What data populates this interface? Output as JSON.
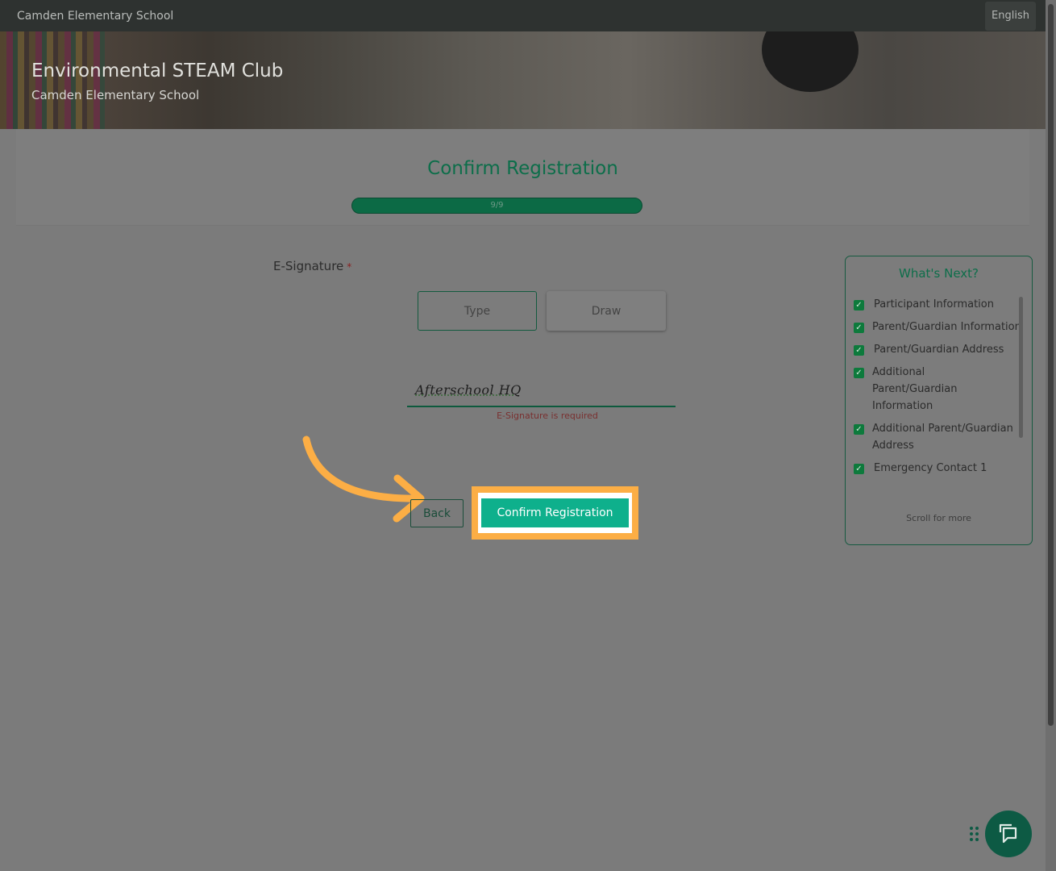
{
  "topbar": {
    "school_name": "Camden Elementary School",
    "language_button": "English"
  },
  "hero": {
    "title": "Environmental STEAM Club",
    "subtitle": "Camden Elementary School"
  },
  "header": {
    "heading": "Confirm Registration",
    "progress_label": "9/9",
    "progress_fraction": 1.0
  },
  "signature": {
    "label": "E-Signature",
    "required_marker": "*",
    "tabs": [
      {
        "label": "Type",
        "selected": true
      },
      {
        "label": "Draw",
        "selected": false
      }
    ],
    "value": "Afterschool HQ",
    "error": "E-Signature is required"
  },
  "actions": {
    "back_label": "Back",
    "confirm_label": "Confirm Registration"
  },
  "whats_next": {
    "title": "What's Next?",
    "items": [
      {
        "label": "Participant Information",
        "checked": true
      },
      {
        "label": "Parent/Guardian Information",
        "checked": true
      },
      {
        "label": "Parent/Guardian Address",
        "checked": true
      },
      {
        "label": "Additional Parent/Guardian Information",
        "checked": true
      },
      {
        "label": "Additional Parent/Guardian Address",
        "checked": true
      },
      {
        "label": "Emergency Contact 1",
        "checked": true
      }
    ],
    "footer": "Scroll for more"
  },
  "colors": {
    "accent_green": "#0eb08c",
    "highlight_orange": "#fcae45",
    "heading_green": "#0d6e4a"
  },
  "icons": {
    "chat": "chat-bubble-icon",
    "drag": "drag-handle-icon",
    "check": "checkbox-checked-icon"
  }
}
